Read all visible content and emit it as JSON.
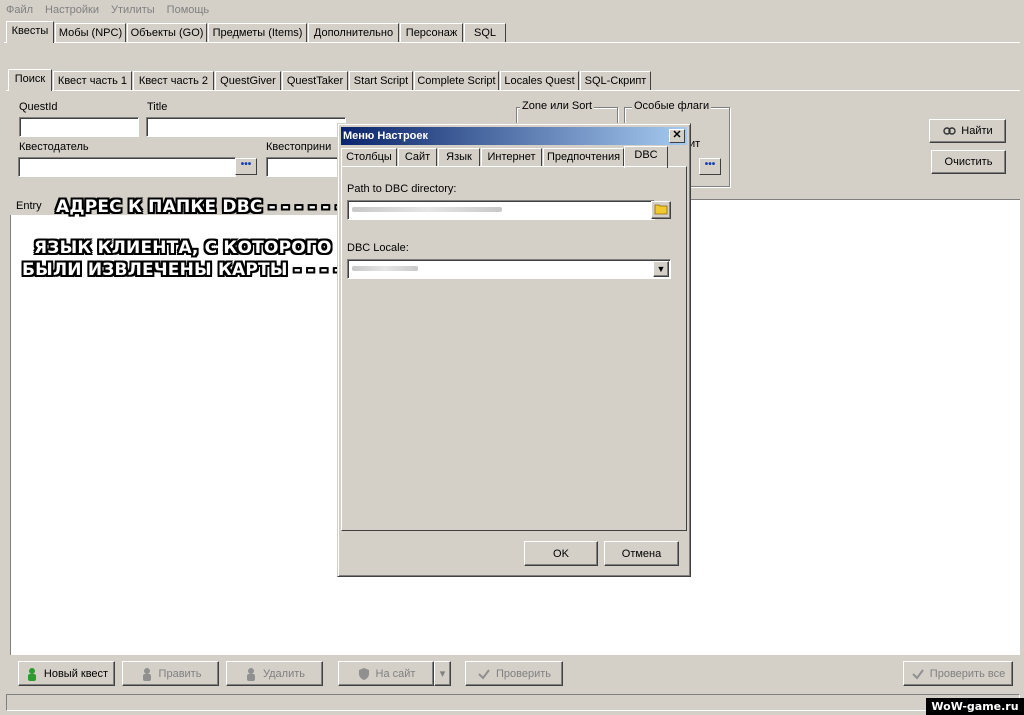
{
  "menubar": {
    "items": [
      "Файл",
      "Настройки",
      "Утилиты",
      "Помощь"
    ]
  },
  "main_tabs": [
    "Квесты",
    "Мобы (NPC)",
    "Объекты (GO)",
    "Предметы (Items)",
    "Дополнительно",
    "Персонаж",
    "SQL"
  ],
  "main_tabs_active": "Квесты",
  "sub_tabs": [
    "Поиск",
    "Квест часть 1",
    "Квест часть 2",
    "QuestGiver",
    "QuestTaker",
    "Start Script",
    "Complete Script",
    "Locales Quest",
    "SQL-Скрипт"
  ],
  "sub_tabs_active": "Поиск",
  "search": {
    "questid_label": "QuestId",
    "title_label": "Title",
    "questgiver_label": "Квестодатель",
    "questtaker_label": "Квестоприни",
    "zone_group_title": "Zone или Sort",
    "flags_group_title": "Особые флаги",
    "script_label_fragment": "ит",
    "find_button": "Найти",
    "clear_button": "Очистить"
  },
  "results": {
    "column_entry": "Entry"
  },
  "annotations": {
    "dbc_path": "АДРЕС К ПАПКЕ DBC - - - - - -",
    "client_lang_line1": "ЯЗЫК КЛИЕНТА, С КОТОРОГО",
    "client_lang_line2": "БЫЛИ ИЗВЛЕЧЕНЫ КАРТЫ - - - -"
  },
  "dialog": {
    "title": "Меню Настроек",
    "close_glyph": "✕",
    "tabs": [
      "Столбцы",
      "Сайт",
      "Язык",
      "Интернет",
      "Предпочтения",
      "DBC"
    ],
    "active_tab": "DBC",
    "dbc_path_label": "Path to DBC directory:",
    "dbc_locale_label": "DBC Locale:",
    "ok_button": "OK",
    "cancel_button": "Отмена"
  },
  "bottom_toolbar": {
    "new_quest": "Новый квест",
    "edit": "Править",
    "delete": "Удалить",
    "to_site": "На сайт",
    "check": "Проверить",
    "check_all": "Проверить все"
  },
  "watermark": "WoW-game.ru",
  "colors": {
    "window_bg": "#d4d0c8",
    "titlebar_start": "#0a246a",
    "titlebar_end": "#a6caf0",
    "disabled_text": "#808080"
  }
}
